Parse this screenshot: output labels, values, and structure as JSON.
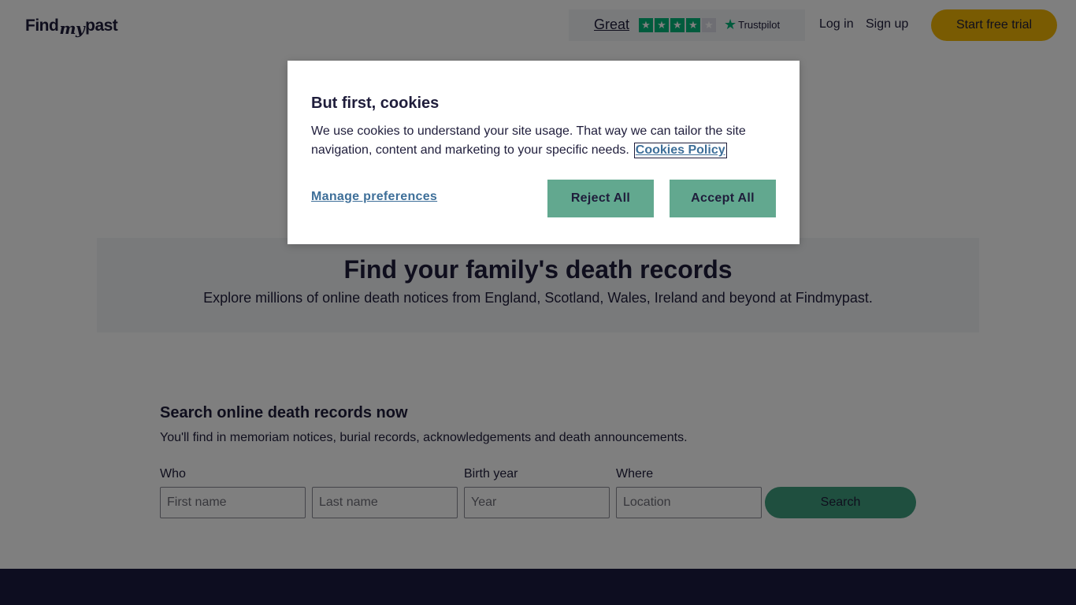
{
  "header": {
    "logo_find": "Find",
    "logo_my": "my",
    "logo_past": "past",
    "trustpilot": {
      "rating_word": "Great",
      "stars_filled": 4,
      "stars_total": 5,
      "brand": "Trustpilot"
    },
    "login_label": "Log in",
    "signup_label": "Sign up",
    "trial_label": "Start free trial"
  },
  "hero": {
    "title": "Find your family's death records",
    "subtitle": "Explore millions of online death notices from England, Scotland, Wales, Ireland and beyond at Findmypast."
  },
  "search": {
    "title": "Search online death records now",
    "subtitle": "You'll find in memoriam notices, burial records, acknowledgements and death announcements.",
    "labels": {
      "who": "Who",
      "birth_year": "Birth year",
      "where": "Where"
    },
    "placeholders": {
      "first_name": "First name",
      "last_name": "Last name",
      "year": "Year",
      "location": "Location"
    },
    "button_label": "Search"
  },
  "cookie_modal": {
    "title": "But first, cookies",
    "body": "We use cookies to understand your site usage. That way we can tailor the site navigation, content and marketing to your specific needs.",
    "policy_link": "Cookies Policy",
    "manage_label": "Manage preferences",
    "reject_label": "Reject All",
    "accept_label": "Accept All"
  },
  "colors": {
    "brand_yellow": "#f2b705",
    "brand_green": "#3f9e7e",
    "modal_button": "#62a88f",
    "navy": "#1a1a40",
    "trustpilot_green": "#00b67a"
  }
}
